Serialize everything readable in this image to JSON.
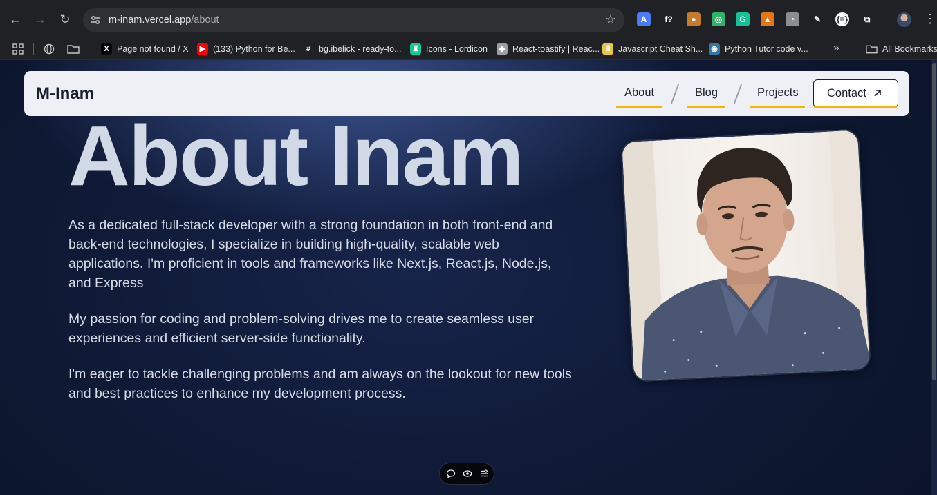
{
  "browser": {
    "url_host": "m-inam.vercel.app",
    "url_path": "/about",
    "extensions": [
      {
        "icon": "translate-icon",
        "color": "#4c7bf3",
        "glyph": "A"
      },
      {
        "icon": "formula-icon",
        "color": "#202124",
        "glyph": "f?"
      },
      {
        "icon": "cookie-icon",
        "color": "#c77a2a",
        "glyph": "●"
      },
      {
        "icon": "circle-ring-icon",
        "color": "#2fb36b",
        "glyph": "◎"
      },
      {
        "icon": "grammarly-icon",
        "color": "#15c39a",
        "glyph": "G"
      },
      {
        "icon": "metamask-icon",
        "color": "#e2761b",
        "glyph": "▲"
      },
      {
        "icon": "owl-icon",
        "color": "#8a8d91",
        "glyph": "◔"
      },
      {
        "icon": "eyedropper-icon",
        "color": "#202124",
        "glyph": "✎"
      },
      {
        "icon": "json-icon",
        "color": "#ffffff",
        "glyph": "{≡}"
      },
      {
        "icon": "puzzle-icon",
        "color": "#202124",
        "glyph": "⧉"
      }
    ],
    "bookmarks": [
      {
        "label": "Page not found / X",
        "icon": "x-logo-icon",
        "color": "#000000",
        "glyph": "X"
      },
      {
        "label": "(133) Python for Be...",
        "icon": "youtube-icon",
        "color": "#ff0000",
        "glyph": "▶"
      },
      {
        "label": "bg.ibelick - ready-to...",
        "icon": "hash-icon",
        "color": "#202124",
        "glyph": "#"
      },
      {
        "label": "Icons - Lordicon",
        "icon": "lordicon-icon",
        "color": "#16c79a",
        "glyph": "♜"
      },
      {
        "label": "React-toastify | Reac...",
        "icon": "toastify-icon",
        "color": "#9aa0a6",
        "glyph": "◆"
      },
      {
        "label": "Javascript Cheat Sh...",
        "icon": "stripes-icon",
        "color": "#e8c547",
        "glyph": "Ⅲ"
      },
      {
        "label": "Python Tutor code v...",
        "icon": "python-icon",
        "color": "#3776ab",
        "glyph": "◉"
      }
    ],
    "bookmarks_folder_label": "=",
    "all_bookmarks": "All Bookmarks"
  },
  "site": {
    "logo": "M-Inam",
    "nav": [
      {
        "label": "About"
      },
      {
        "label": "Blog"
      },
      {
        "label": "Projects"
      }
    ],
    "contact": "Contact"
  },
  "about": {
    "title": "About Inam",
    "paragraphs": [
      "As a dedicated full-stack developer with a strong foundation in both front-end and back-end technologies, I specialize in building high-quality, scalable web applications. I'm proficient in tools and frameworks like Next.js, React.js, Node.js, and Express",
      "My passion for coding and problem-solving drives me to create seamless user experiences and efficient server-side functionality.",
      "I'm eager to tackle challenging problems and am always on the lookout for new tools and best practices to enhance my development process."
    ]
  },
  "colors": {
    "accent": "#f2b600",
    "navbar_bg": "#eef0f5",
    "page_bg": "#0f1730",
    "title": "#d2d9e6"
  }
}
